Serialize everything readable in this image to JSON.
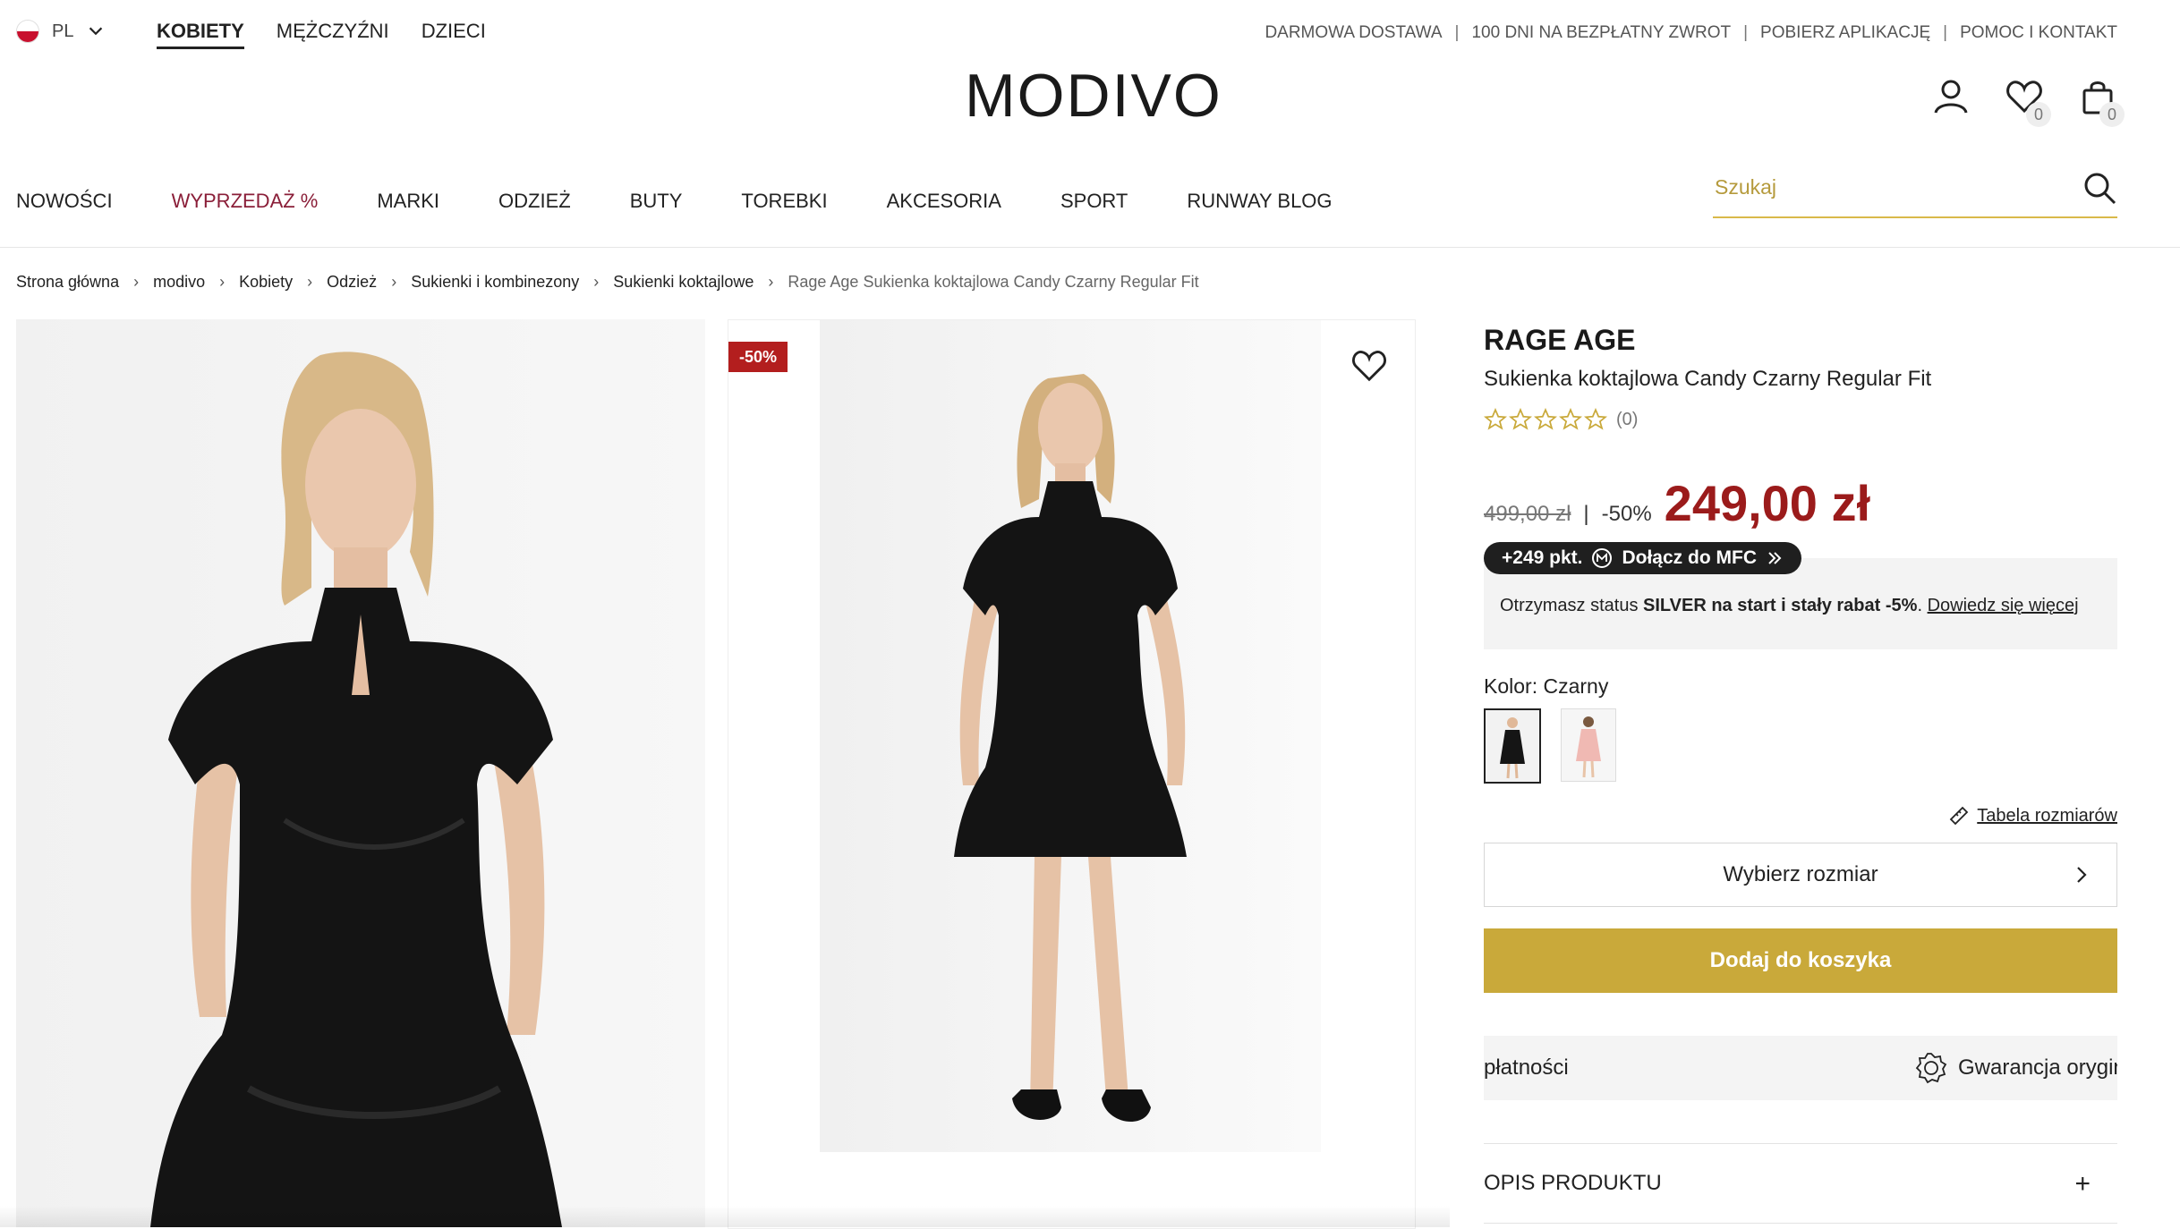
{
  "header": {
    "language": "PL",
    "genders": [
      "KOBIETY",
      "MĘŻCZYŹNI",
      "DZIECI"
    ],
    "active_gender": "KOBIETY",
    "info_links": [
      "DARMOWA DOSTAWA",
      "100 DNI NA BEZPŁATNY ZWROT",
      "POBIERZ APLIKACJĘ",
      "POMOC I KONTAKT"
    ],
    "logo": "MODIVO",
    "wishlist_count": "0",
    "cart_count": "0"
  },
  "nav": {
    "items": [
      "NOWOŚCI",
      "WYPRZEDAŻ %",
      "MARKI",
      "ODZIEŻ",
      "BUTY",
      "TOREBKI",
      "AKCESORIA",
      "SPORT",
      "RUNWAY BLOG"
    ],
    "search_placeholder": "Szukaj"
  },
  "breadcrumb": [
    "Strona główna",
    "modivo",
    "Kobiety",
    "Odzież",
    "Sukienki i kombinezony",
    "Sukienki koktajlowe",
    "Rage Age Sukienka koktajlowa Candy Czarny Regular Fit"
  ],
  "gallery": {
    "discount_badge": "-50%"
  },
  "product": {
    "brand": "RAGE AGE",
    "name": "Sukienka koktajlowa Candy Czarny Regular Fit",
    "rating_stars": 0,
    "rating_count": "(0)",
    "old_price": "499,00 zł",
    "separator": "|",
    "discount": "-50%",
    "price": "249,00 zł",
    "mfc_points": "+249 pkt.",
    "mfc_join": "Dołącz do MFC",
    "mfc_text_1": "Otrzymasz status ",
    "mfc_text_bold": "SILVER na start i stały rabat -5%",
    "mfc_text_2": ". ",
    "mfc_link": "Dowiedz się więcej",
    "color_label": "Kolor: Czarny",
    "size_table": "Tabela rozmiarów",
    "size_button": "Wybierz rozmiar",
    "add_to_cart": "Dodaj do koszyka",
    "usp_1": "płatności",
    "usp_2": "Gwarancja orygin",
    "description_label": "OPIS PRODUKTU"
  },
  "colors": {
    "accent_gold": "#c9a93a",
    "price_red": "#9b1b1b",
    "sale_burgundy": "#8a1e38"
  }
}
